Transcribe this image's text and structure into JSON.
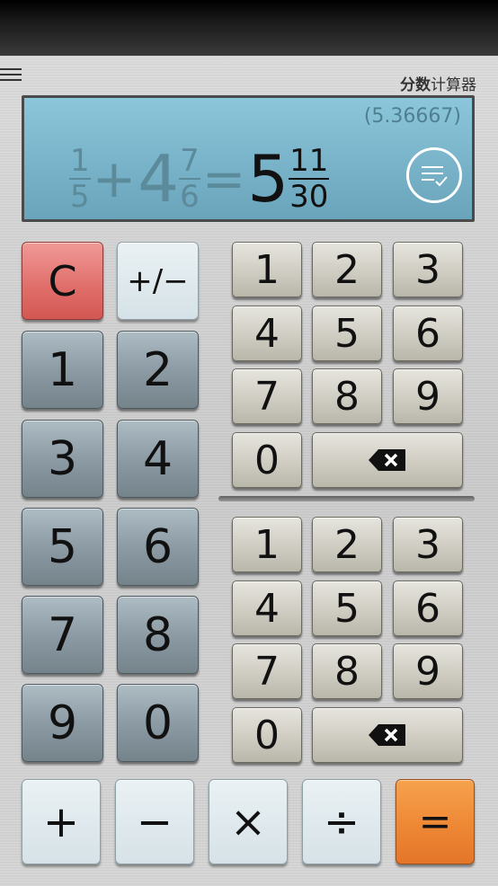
{
  "app": {
    "title_bold": "分数",
    "title_rest": "计算器"
  },
  "display": {
    "decimal_result": "(5.36667)",
    "expression": {
      "term1": {
        "numerator": "1",
        "denominator": "5"
      },
      "operator": "+",
      "term2": {
        "whole": "4",
        "numerator": "7",
        "denominator": "6"
      },
      "equals": "=",
      "result": {
        "whole": "5",
        "numerator": "11",
        "denominator": "30"
      }
    }
  },
  "left_keypad": {
    "clear": "C",
    "sign": "+/−",
    "keys": [
      "1",
      "2",
      "3",
      "4",
      "5",
      "6",
      "7",
      "8",
      "9",
      "0"
    ]
  },
  "numerator_keypad": {
    "keys": [
      "1",
      "2",
      "3",
      "4",
      "5",
      "6",
      "7",
      "8",
      "9",
      "0"
    ]
  },
  "denominator_keypad": {
    "keys": [
      "1",
      "2",
      "3",
      "4",
      "5",
      "6",
      "7",
      "8",
      "9",
      "0"
    ]
  },
  "operators": [
    "+",
    "−",
    "×",
    "÷",
    "="
  ],
  "colors": {
    "display_bg": "#78b3c9",
    "clear_key": "#e06d69",
    "equals_key": "#ee8835"
  }
}
